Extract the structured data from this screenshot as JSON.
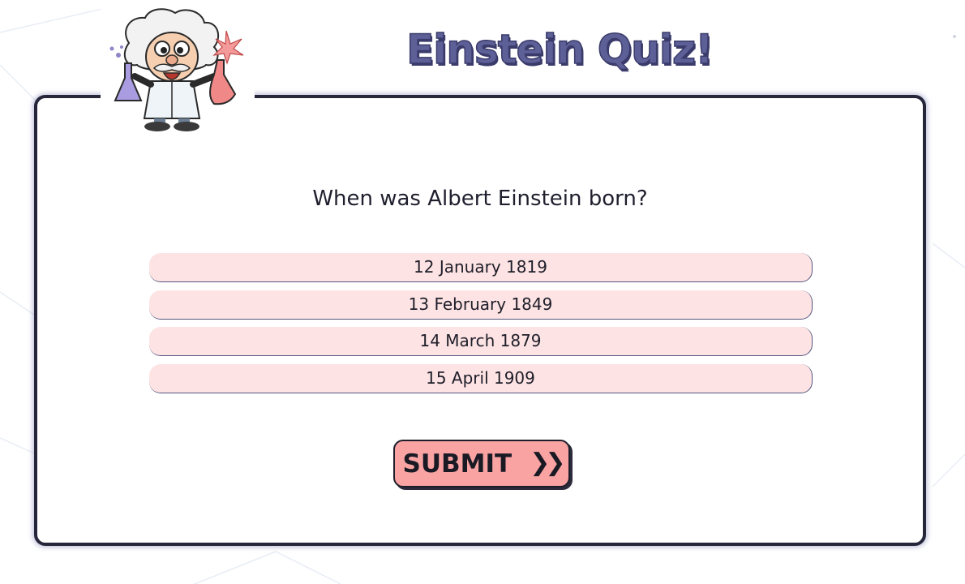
{
  "header": {
    "title": "Einstein Quiz!"
  },
  "quiz": {
    "question": "When was Albert Einstein born?",
    "options": [
      "12 January 1819",
      "13 February 1849",
      "14 March 1879",
      "15 April 1909"
    ],
    "submit_label": "SUBMIT",
    "submit_icon": "double-chevron-right-icon"
  },
  "mascot": {
    "icon": "einstein-cartoon-mascot"
  },
  "colors": {
    "title": "#5d5f97",
    "card_border": "#25263a",
    "option_bg": "#fde3e3",
    "submit_bg": "#f9a3a3"
  }
}
